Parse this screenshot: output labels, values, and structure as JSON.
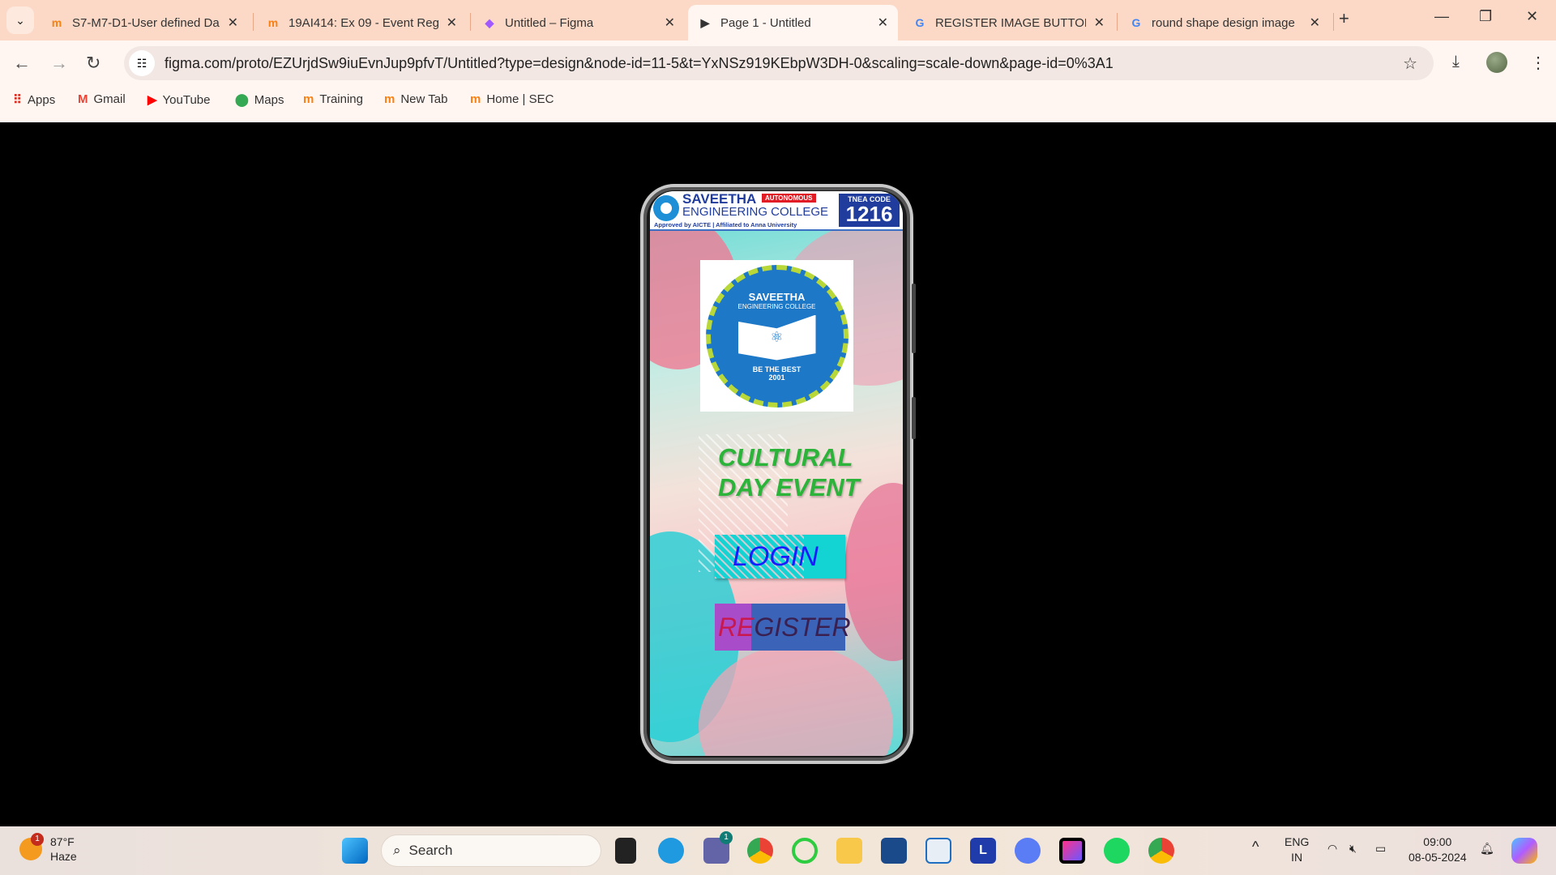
{
  "browser": {
    "tabs": [
      {
        "title": "S7-M7-D1-User defined Da",
        "icon": "moodle-icon",
        "active": false
      },
      {
        "title": "19AI414: Ex 09 - Event Reg",
        "icon": "moodle-icon",
        "active": false
      },
      {
        "title": "Untitled – Figma",
        "icon": "figma-icon",
        "active": false
      },
      {
        "title": "Page 1 - Untitled",
        "icon": "play-icon",
        "active": true
      },
      {
        "title": "REGISTER IMAGE BUTTON",
        "icon": "google-icon",
        "active": false
      },
      {
        "title": "round shape design image",
        "icon": "google-icon",
        "active": false
      }
    ],
    "url": "figma.com/proto/EZUrjdSw9iuEvnJup9pfvT/Untitled?type=design&node-id=11-5&t=YxNSz919KEbpW3DH-0&scaling=scale-down&page-id=0%3A1",
    "bookmarks": [
      {
        "label": "Apps",
        "icon": "apps-grid-icon",
        "color": "#d93025"
      },
      {
        "label": "Gmail",
        "icon": "gmail-icon",
        "color": "#ea4335"
      },
      {
        "label": "YouTube",
        "icon": "youtube-icon",
        "color": "#ff0000"
      },
      {
        "label": "Maps",
        "icon": "maps-icon",
        "color": "#34a853"
      },
      {
        "label": "Training",
        "icon": "moodle-icon",
        "color": "#f98012"
      },
      {
        "label": "New Tab",
        "icon": "moodle-icon",
        "color": "#f98012"
      },
      {
        "label": "Home | SEC",
        "icon": "moodle-icon",
        "color": "#f98012"
      }
    ]
  },
  "prototype": {
    "header": {
      "line1": "SAVEETHA",
      "line2": "ENGINEERING COLLEGE",
      "autonomous": "AUTONOMOUS",
      "approved": "Approved by AICTE  |  Affiliated to Anna University",
      "tnea_label": "TNEA CODE",
      "tnea_code": "1216"
    },
    "logo": {
      "name": "SAVEETHA",
      "sub": "ENGINEERING COLLEGE",
      "motto": "BE THE BEST",
      "year": "2001"
    },
    "title_line1": "CULTURAL",
    "title_line2": "DAY EVENT",
    "login_label": "LOGIN",
    "register_label_a": "RE",
    "register_label_b": "GISTER",
    "colors": {
      "title": "#2bb33a",
      "login_bg": "#13d3d3",
      "login_text": "#1a1aff",
      "register_bg": "#3b64b8"
    }
  },
  "taskbar": {
    "weather": {
      "temp": "87°F",
      "condition": "Haze",
      "badge": "1"
    },
    "search_placeholder": "Search",
    "teams_badge": "1",
    "lang1": "ENG",
    "lang2": "IN",
    "time": "09:00",
    "date": "08-05-2024"
  }
}
